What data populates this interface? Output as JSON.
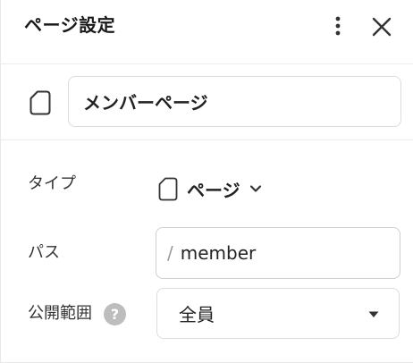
{
  "header": {
    "title": "ページ設定",
    "more_icon": "more-vertical-icon",
    "close_icon": "close-icon"
  },
  "page_name": {
    "icon": "page-icon",
    "value": "メンバーページ"
  },
  "fields": {
    "type": {
      "label": "タイプ",
      "icon": "page-icon",
      "value": "ページ",
      "caret_icon": "chevron-down-icon"
    },
    "path": {
      "label": "パス",
      "prefix": "/",
      "value": "member"
    },
    "visibility": {
      "label": "公開範囲",
      "help_icon": "help-icon",
      "help_glyph": "?",
      "value": "全員",
      "caret_icon": "caret-down-icon"
    }
  }
}
